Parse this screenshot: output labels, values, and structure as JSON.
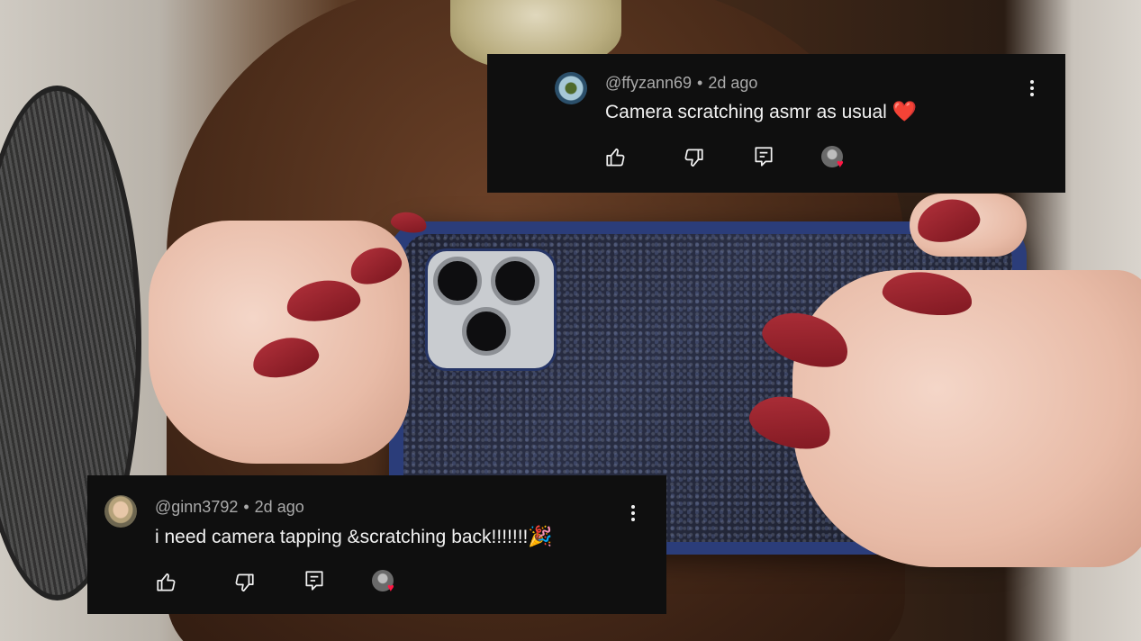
{
  "comments": [
    {
      "handle": "@ffyzann69",
      "separator": "•",
      "age": "2d ago",
      "text": "Camera scratching asmr as usual ",
      "emoji": "❤️",
      "avatar_icon": "profile-photo-avatar",
      "actions": [
        "like-icon",
        "dislike-icon",
        "reply-icon",
        "creator-heart-icon"
      ]
    },
    {
      "handle": "@ginn3792",
      "separator": "•",
      "age": "2d ago",
      "text": "i need camera tapping &scratching back!!!!!!!",
      "emoji": "🎉",
      "avatar_icon": "profile-photo-avatar",
      "actions": [
        "like-icon",
        "dislike-icon",
        "reply-icon",
        "creator-heart-icon"
      ]
    }
  ],
  "colors": {
    "card_bg": "#0f0f0f",
    "text": "#f1f1f1",
    "meta": "#aaaaaa",
    "heart": "#ff1744"
  }
}
